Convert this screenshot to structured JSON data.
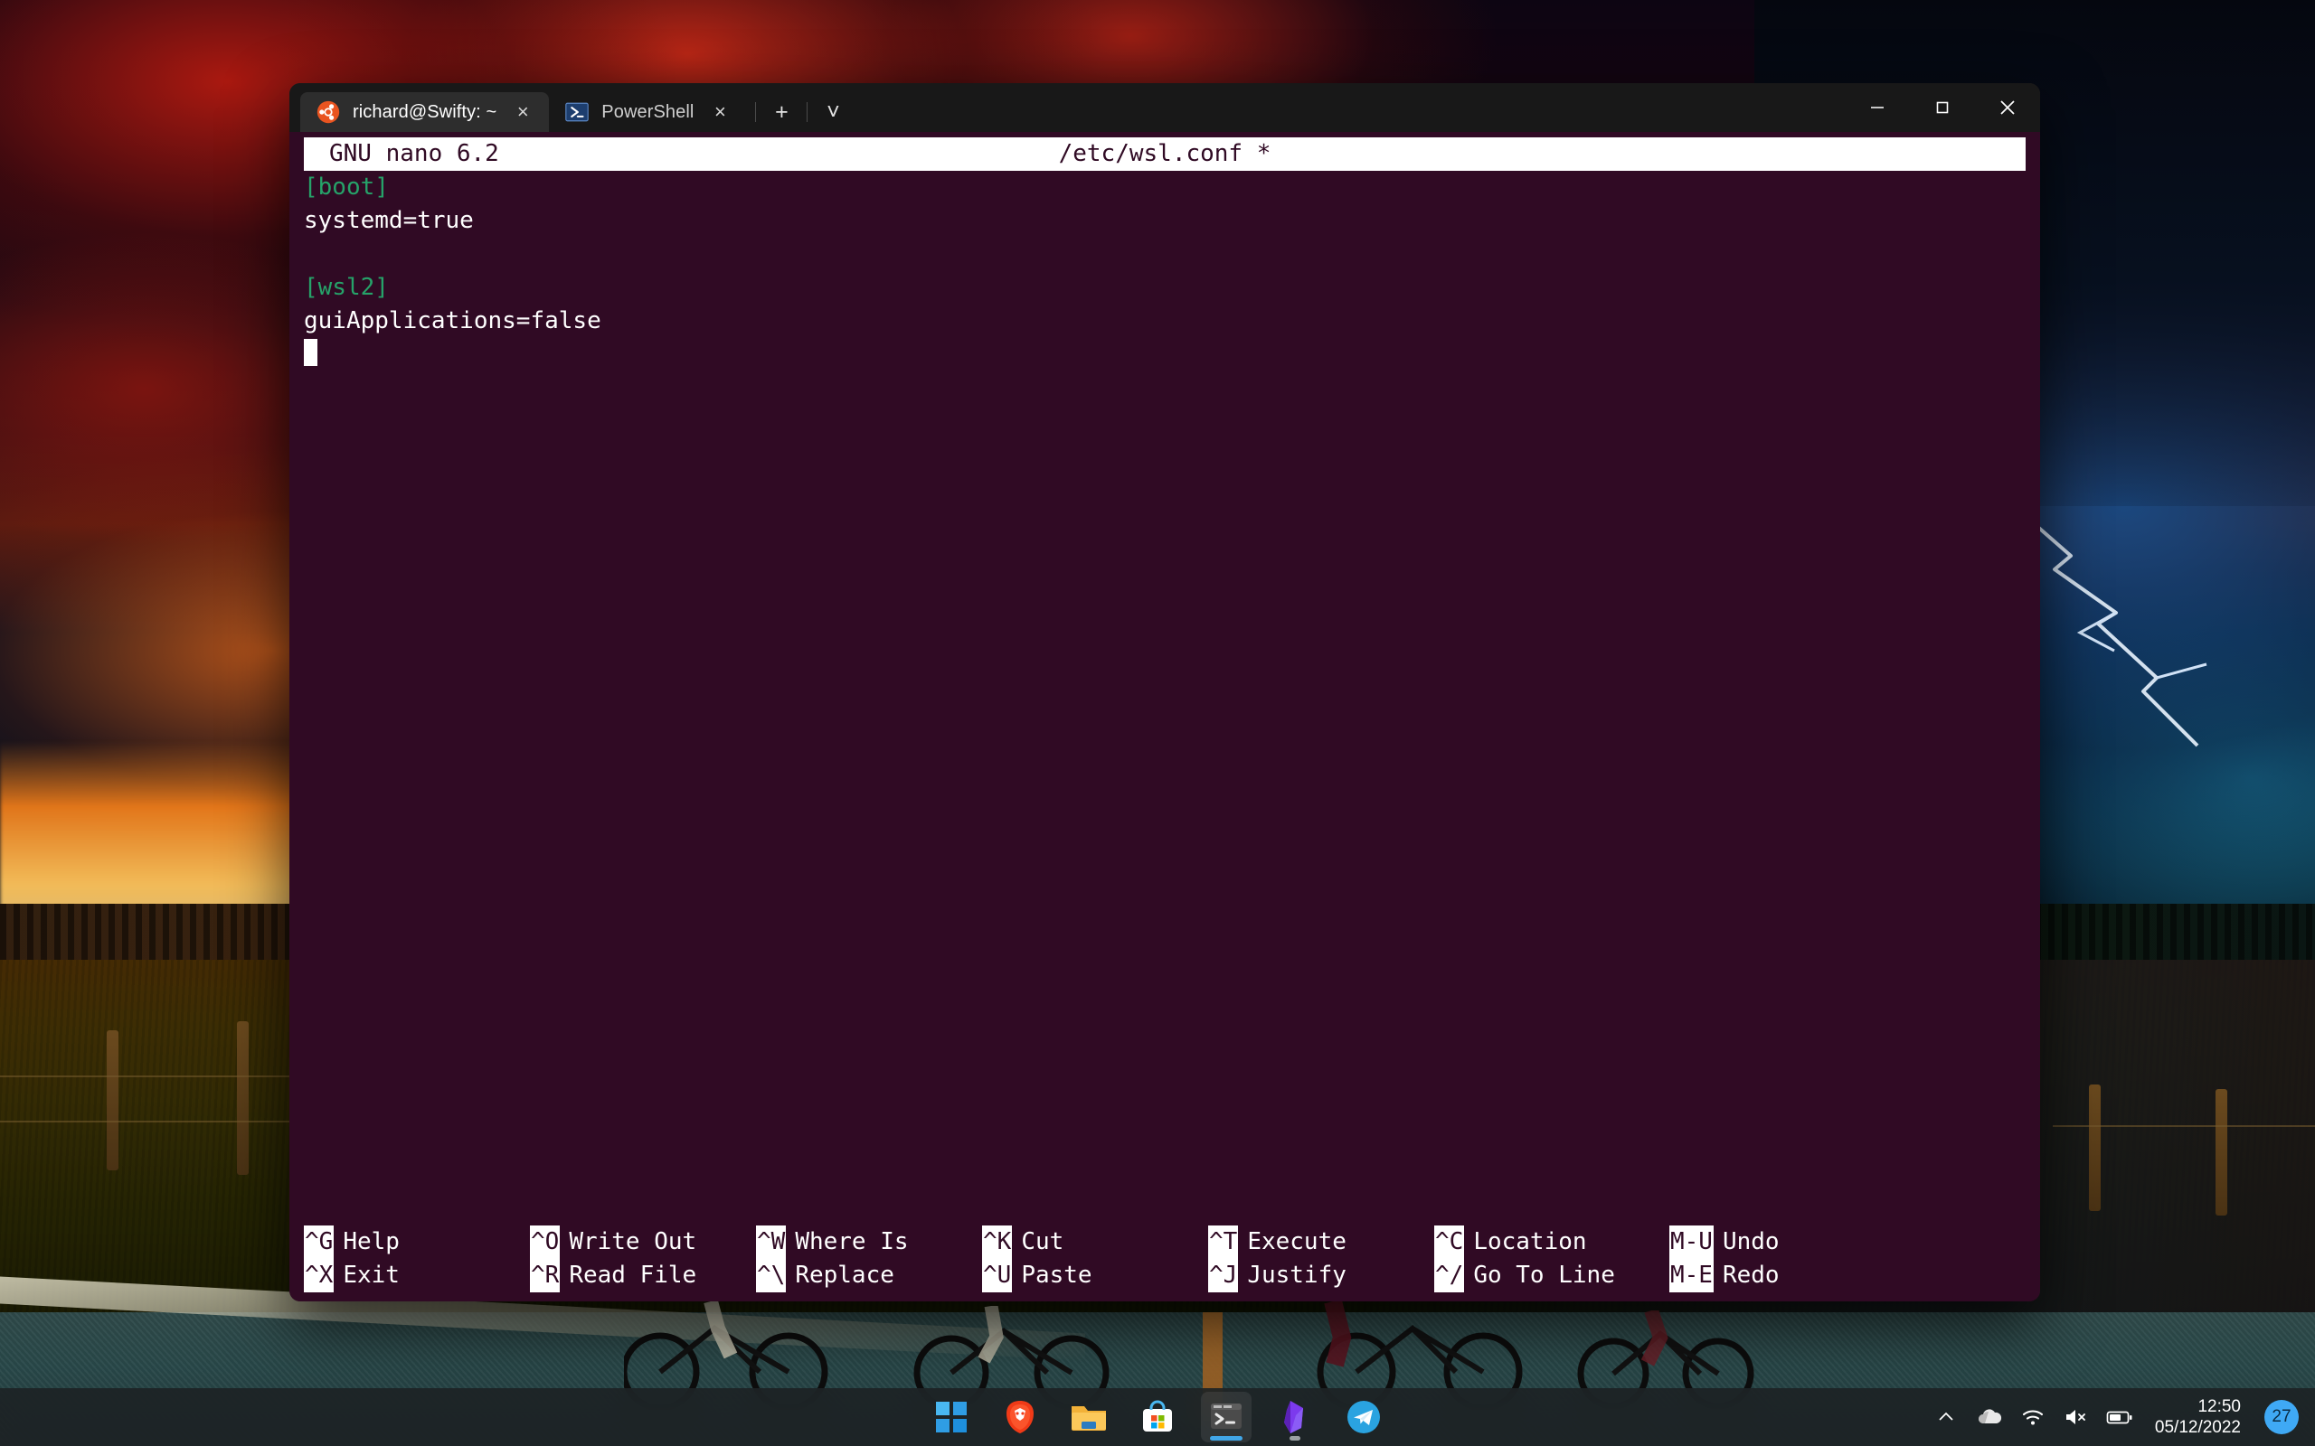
{
  "window": {
    "tabs": [
      {
        "label": "richard@Swifty: ~",
        "icon": "ubuntu-icon",
        "close_label": "×",
        "active": true
      },
      {
        "label": "PowerShell",
        "icon": "powershell-icon",
        "close_label": "×",
        "active": false
      }
    ],
    "new_tab_label": "+",
    "dropdown_label": "˅",
    "controls": {
      "minimize": "—",
      "maximize": "□",
      "close": "✕"
    }
  },
  "nano": {
    "version": "GNU nano 6.2",
    "filename": "/etc/wsl.conf *",
    "lines": [
      {
        "text": "[boot]",
        "type": "section"
      },
      {
        "text": "systemd=true",
        "type": "plain"
      },
      {
        "text": "",
        "type": "plain"
      },
      {
        "text": "[wsl2]",
        "type": "section"
      },
      {
        "text": "guiApplications=false",
        "type": "plain"
      }
    ],
    "shortcuts": [
      [
        {
          "key": "^G",
          "label": "Help"
        },
        {
          "key": "^X",
          "label": "Exit"
        }
      ],
      [
        {
          "key": "^O",
          "label": "Write Out"
        },
        {
          "key": "^R",
          "label": "Read File"
        }
      ],
      [
        {
          "key": "^W",
          "label": "Where Is"
        },
        {
          "key": "^\\",
          "label": "Replace"
        }
      ],
      [
        {
          "key": "^K",
          "label": "Cut"
        },
        {
          "key": "^U",
          "label": "Paste"
        }
      ],
      [
        {
          "key": "^T",
          "label": "Execute"
        },
        {
          "key": "^J",
          "label": "Justify"
        }
      ],
      [
        {
          "key": "^C",
          "label": "Location"
        },
        {
          "key": "^/",
          "label": "Go To Line"
        }
      ],
      [
        {
          "key": "M-U",
          "label": "Undo"
        },
        {
          "key": "M-E",
          "label": "Redo"
        }
      ]
    ]
  },
  "taskbar": {
    "items": [
      {
        "name": "start-button",
        "icon": "windows-icon"
      },
      {
        "name": "brave-browser",
        "icon": "brave-icon",
        "running": true
      },
      {
        "name": "file-explorer",
        "icon": "folder-icon"
      },
      {
        "name": "microsoft-store",
        "icon": "store-icon"
      },
      {
        "name": "windows-terminal",
        "icon": "terminal-icon",
        "active": true
      },
      {
        "name": "obsidian",
        "icon": "obsidian-icon",
        "running": true
      },
      {
        "name": "telegram",
        "icon": "telegram-icon"
      }
    ],
    "tray": {
      "overflow": "chevron-up-icon",
      "onedrive": "cloud-icon",
      "network": "wifi-icon",
      "volume": "speaker-muted-icon",
      "battery": "battery-icon",
      "time": "12:50",
      "date": "05/12/2022",
      "notification_count": "27"
    }
  },
  "colors": {
    "terminal_bg": "#300a24",
    "section_green": "#26a269",
    "accent_blue": "#3fa9f5",
    "ubuntu_orange": "#e95420"
  }
}
